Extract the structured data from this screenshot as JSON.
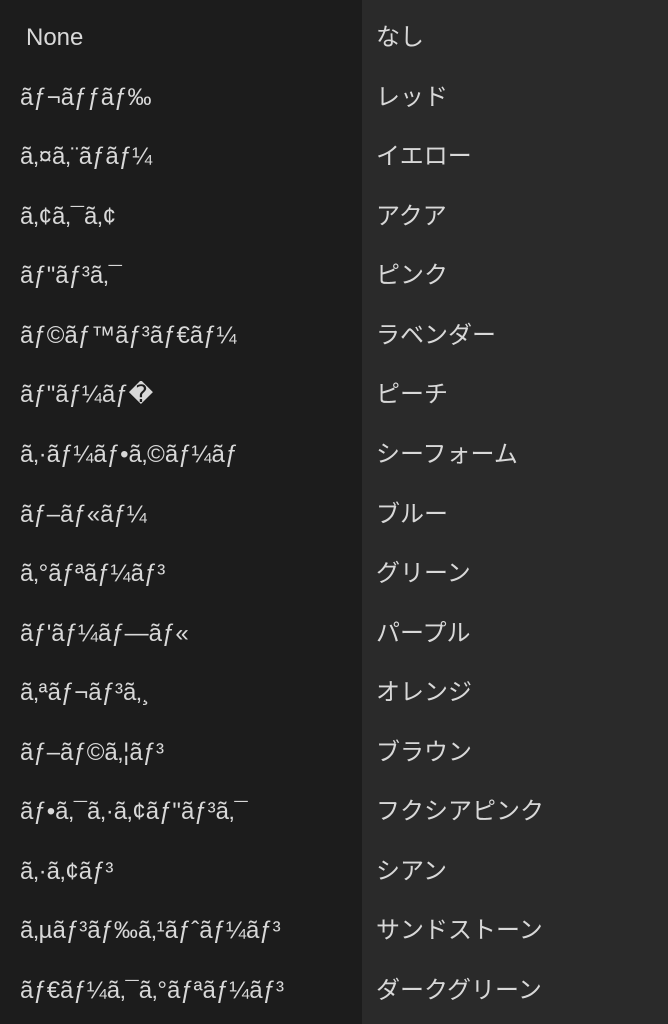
{
  "left": [
    "None",
    "ãƒ¬ãƒƒãƒ‰",
    "ã‚¤ã‚¨ãƒãƒ¼",
    "ã‚¢ã‚¯ã‚¢",
    "ãƒ\"ãƒ³ã‚¯",
    "ãƒ©ãƒ™ãƒ³ãƒ€ãƒ¼",
    "ãƒ\"ãƒ¼ãƒ�",
    "ã‚·ãƒ¼ãƒ•ã‚©ãƒ¼ãƒ",
    "ãƒ–ãƒ«ãƒ¼",
    "ã‚°ãƒªãƒ¼ãƒ³",
    "ãƒ'ãƒ¼ãƒ—ãƒ«",
    "ã‚ªãƒ¬ãƒ³ã‚¸",
    "ãƒ–ãƒ©ã‚¦ãƒ³",
    "ãƒ•ã‚¯ã‚·ã‚¢ãƒ\"ãƒ³ã‚¯",
    "ã‚·ã‚¢ãƒ³",
    "ã‚µãƒ³ãƒ‰ã‚¹ãƒˆãƒ¼ãƒ³",
    "ãƒ€ãƒ¼ã‚¯ã‚°ãƒªãƒ¼ãƒ³"
  ],
  "right": [
    "なし",
    "レッド",
    "イエロー",
    "アクア",
    "ピンク",
    "ラベンダー",
    "ピーチ",
    "シーフォーム",
    "ブルー",
    "グリーン",
    "パープル",
    "オレンジ",
    "ブラウン",
    "フクシアピンク",
    "シアン",
    "サンドストーン",
    "ダークグリーン"
  ]
}
